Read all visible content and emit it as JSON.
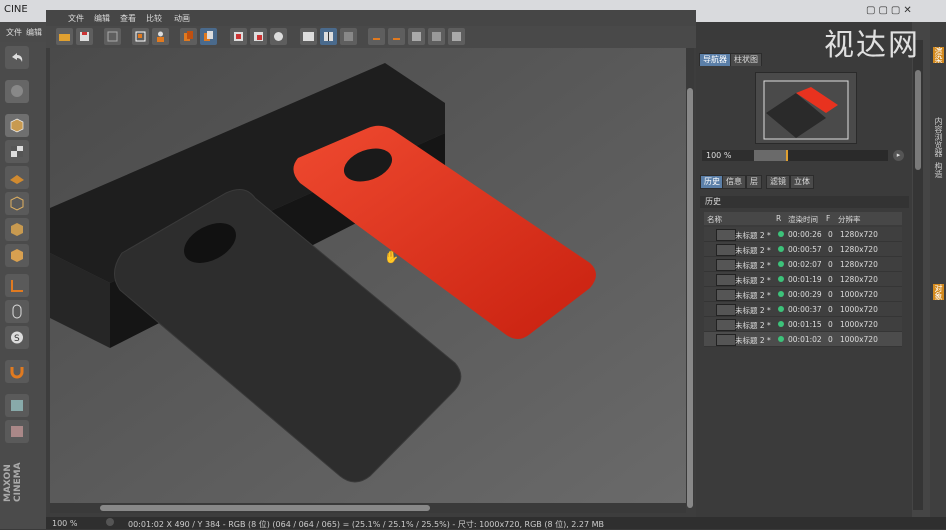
{
  "app": {
    "title_fragment": "CINE",
    "watermark": "视达网"
  },
  "left_menu": [
    "文件",
    "编辑"
  ],
  "viewport_menu": [
    "文件",
    "编辑",
    "查看",
    "比较",
    "动画"
  ],
  "left_tools": [
    "undo-icon",
    "render-icon",
    "cube-icon",
    "checker-cube-icon",
    "grid-icon",
    "cube-outline-icon",
    "cube-tool-icon",
    "cube-tool2-icon",
    "axis-icon",
    "mouse-icon",
    "s-tool-icon",
    "magnet-icon",
    "lock-grid-icon",
    "lock-grid2-icon"
  ],
  "navigator": {
    "tabs": [
      "导航器",
      "柱状图"
    ],
    "zoom": "100 %"
  },
  "history_tabs": [
    "历史",
    "信息",
    "层",
    "滤镜",
    "立体"
  ],
  "history": {
    "title": "历史",
    "columns": {
      "name": "名称",
      "r": "R",
      "time": "渲染时间",
      "f": "F",
      "res": "分辨率"
    },
    "rows": [
      {
        "name": "未标题 2 *",
        "time": "00:00:26",
        "f": "0",
        "res": "1280x720"
      },
      {
        "name": "未标题 2 *",
        "time": "00:00:57",
        "f": "0",
        "res": "1280x720"
      },
      {
        "name": "未标题 2 *",
        "time": "00:02:07",
        "f": "0",
        "res": "1280x720"
      },
      {
        "name": "未标题 2 *",
        "time": "00:01:19",
        "f": "0",
        "res": "1280x720"
      },
      {
        "name": "未标题 2 *",
        "time": "00:00:29",
        "f": "0",
        "res": "1000x720"
      },
      {
        "name": "未标题 2 *",
        "time": "00:00:37",
        "f": "0",
        "res": "1000x720"
      },
      {
        "name": "未标题 2 *",
        "time": "00:01:15",
        "f": "0",
        "res": "1000x720"
      },
      {
        "name": "未标题 2 *",
        "time": "00:01:02",
        "f": "0",
        "res": "1000x720"
      }
    ]
  },
  "right_strip": [
    "渲染",
    "内容浏览器",
    "构造",
    "对象"
  ],
  "status": {
    "zoom": "100 %",
    "text": "00:01:02     X 490 / Y 384 - RGB (8 位) (064 / 064 / 065) = (25.1% / 25.1% / 25.5%) - 尺寸: 1000x720, RGB (8 位), 2.27 MB"
  },
  "colors": {
    "phone_red": "#e8321f",
    "phone_black": "#2d2d2d",
    "accent": "#5b7fa8",
    "status_green": "#3cc37a"
  }
}
